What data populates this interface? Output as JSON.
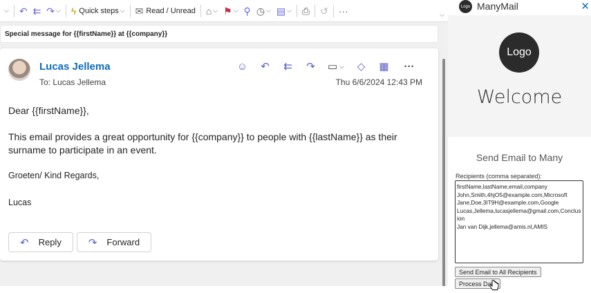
{
  "toolbar": {
    "quick_steps_label": "Quick steps",
    "read_unread_label": "Read / Unread"
  },
  "message": {
    "subject": "Special message for {{firstName}} at {{company}}",
    "sender": "Lucas Jellema",
    "to": "To:  Lucas Jellema",
    "timestamp": "Thu 6/6/2024 12:43 PM",
    "greeting": "Dear {{firstName}},",
    "body": "This email provides a great opportunity for {{company}} to people with {{lastName}} as their surname to participate in an event.",
    "closing": "Groeten/ Kind Regards,",
    "signature": "Lucas",
    "reply_label": "Reply",
    "forward_label": "Forward"
  },
  "addin": {
    "logo_small": "Logo",
    "name": "ManyMail",
    "logo_large": "Logo",
    "welcome": "Welcome",
    "section_title": "Send Email to Many",
    "recipients_label": "Recipients (comma separated):",
    "recipients_lines": [
      "firstName,lastName,email,company",
      "John,Smith,4hjO5@example.com,Microsoft",
      "Jane,Doe,3IT9H@example.com,Google",
      "Lucas,Jellema,lucasjellema@gmail.com,Conclusion",
      "Jan van Dijk,jellema@amis.nl,AMIS"
    ],
    "send_button": "Send Email to All Recipients",
    "process_button": "Process Data"
  },
  "colors": {
    "accent": "#5b5fc7",
    "sender_link": "#0f6cbd",
    "flag": "#c4314b"
  }
}
